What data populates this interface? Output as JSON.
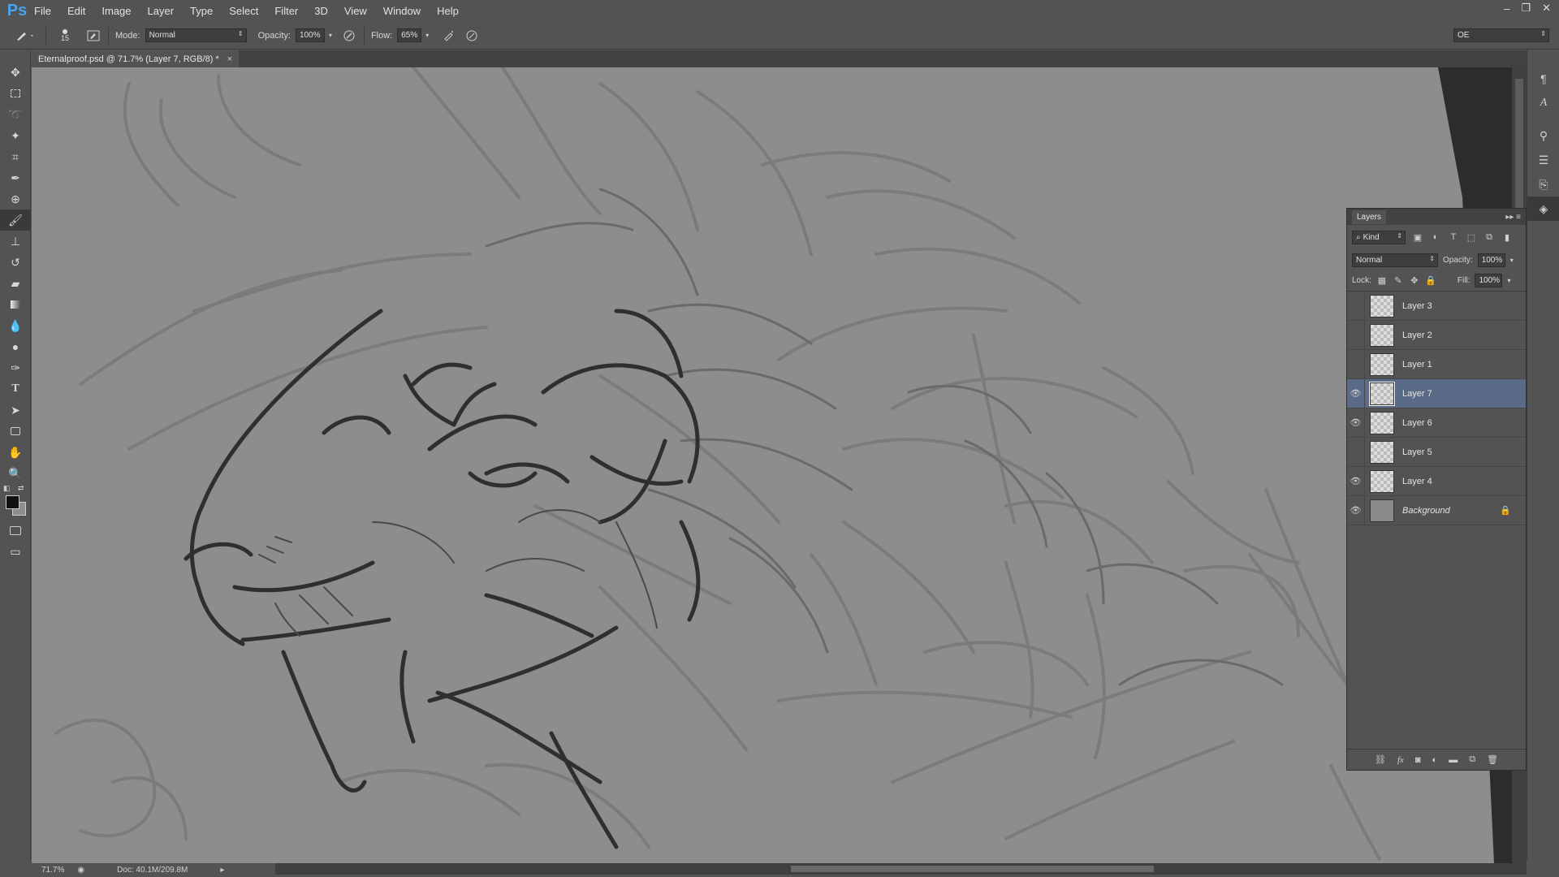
{
  "app": {
    "logo": "Ps"
  },
  "menu": [
    "File",
    "Edit",
    "Image",
    "Layer",
    "Type",
    "Select",
    "Filter",
    "3D",
    "View",
    "Window",
    "Help"
  ],
  "window_controls": {
    "minimize": "–",
    "restore": "❐",
    "close": "✕"
  },
  "options": {
    "brush_size": "15",
    "mode_label": "Mode:",
    "mode_value": "Normal",
    "opacity_label": "Opacity:",
    "opacity_value": "100%",
    "flow_label": "Flow:",
    "flow_value": "65%",
    "workspace": "OE"
  },
  "document": {
    "tab_title": "Eternalproof.psd @ 71.7% (Layer 7, RGB/8) *",
    "close": "×",
    "zoom": "71.7%",
    "doc_info": "Doc: 40.1M/209.8M"
  },
  "layers_panel": {
    "title": "Layers",
    "filter_kind": "Kind",
    "blend_mode": "Normal",
    "opacity_label": "Opacity:",
    "opacity_value": "100%",
    "lock_label": "Lock:",
    "fill_label": "Fill:",
    "fill_value": "100%",
    "layers": [
      {
        "name": "Layer 3",
        "visible": false
      },
      {
        "name": "Layer 2",
        "visible": false
      },
      {
        "name": "Layer 1",
        "visible": false
      },
      {
        "name": "Layer 7",
        "visible": true,
        "selected": true
      },
      {
        "name": "Layer 6",
        "visible": true
      },
      {
        "name": "Layer 5",
        "visible": false
      },
      {
        "name": "Layer 4",
        "visible": true
      },
      {
        "name": "Background",
        "visible": true,
        "locked": true
      }
    ]
  },
  "colors": {
    "ui_bg": "#535353",
    "canvas_gray": "#8d8d8d",
    "selected_layer": "#5b6a86",
    "sketch_stroke": "#3a3a3a"
  }
}
